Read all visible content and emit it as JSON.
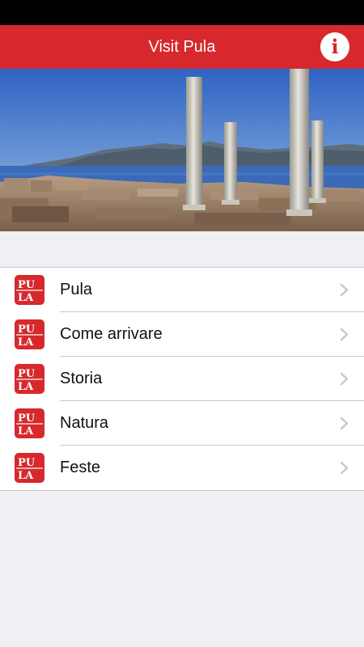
{
  "app": {
    "title": "Visit Pula",
    "brand_color": "#d7282d"
  },
  "header": {
    "info_icon": "info-icon",
    "info_glyph": "i"
  },
  "menu": {
    "items": [
      {
        "label": "Pula",
        "icon": "pula-logo-icon"
      },
      {
        "label": "Come arrivare",
        "icon": "pula-logo-icon"
      },
      {
        "label": "Storia",
        "icon": "pula-logo-icon"
      },
      {
        "label": "Natura",
        "icon": "pula-logo-icon"
      },
      {
        "label": "Feste",
        "icon": "pula-logo-icon"
      }
    ]
  }
}
